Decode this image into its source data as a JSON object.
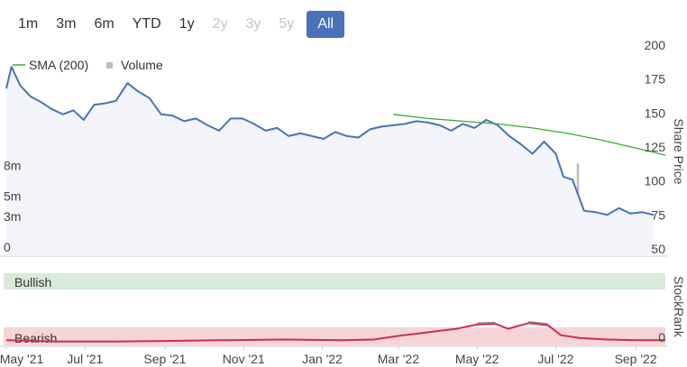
{
  "range_buttons": [
    {
      "label": "1m",
      "state": "enabled"
    },
    {
      "label": "3m",
      "state": "enabled"
    },
    {
      "label": "6m",
      "state": "enabled"
    },
    {
      "label": "YTD",
      "state": "enabled"
    },
    {
      "label": "1y",
      "state": "enabled"
    },
    {
      "label": "2y",
      "state": "disabled"
    },
    {
      "label": "3y",
      "state": "disabled"
    },
    {
      "label": "5y",
      "state": "disabled"
    },
    {
      "label": "All",
      "state": "active"
    }
  ],
  "colors": {
    "price_line": "#4a72b8",
    "price_fill": "#f3f5fa",
    "sma_line": "#3aaa35",
    "volume_bar": "#bdbdbd",
    "bullish_band": "#d8ebd8",
    "bearish_band": "#f5d5d8",
    "stockrank_line": "#c8324a",
    "stockrank_upper": "#8a8a8a",
    "active_button": "#4a72b8"
  },
  "chart_data": [
    {
      "type": "line",
      "title": "",
      "ylabel": "Share Price",
      "ylim": [
        50,
        200
      ],
      "y_ticks": [
        "200",
        "175",
        "150",
        "125",
        "100",
        "75",
        "50"
      ],
      "volume_ticks": [
        "8m",
        "5m",
        "3m",
        "0"
      ],
      "volume_ylim": [
        0,
        10
      ],
      "x_ticks": [
        "May '21",
        "Jul '21",
        "Sep '21",
        "Nov '21",
        "Jan '22",
        "Mar '22",
        "May '22",
        "Jul '22",
        "Sep '22"
      ],
      "legend": [
        {
          "name": "SMA (200)",
          "icon": "line"
        },
        {
          "name": "Volume",
          "icon": "square"
        }
      ],
      "series": [
        {
          "name": "Price",
          "x": [
            "2021-05-01",
            "2021-05-05",
            "2021-05-12",
            "2021-05-20",
            "2021-05-28",
            "2021-06-05",
            "2021-06-14",
            "2021-06-22",
            "2021-06-30",
            "2021-07-08",
            "2021-07-16",
            "2021-07-25",
            "2021-08-03",
            "2021-08-11",
            "2021-08-20",
            "2021-08-29",
            "2021-09-07",
            "2021-09-16",
            "2021-09-25",
            "2021-10-04",
            "2021-10-13",
            "2021-10-22",
            "2021-10-31",
            "2021-11-09",
            "2021-11-18",
            "2021-11-27",
            "2021-12-06",
            "2021-12-15",
            "2021-12-24",
            "2022-01-02",
            "2022-01-11",
            "2022-01-20",
            "2022-01-29",
            "2022-02-07",
            "2022-02-16",
            "2022-02-25",
            "2022-03-06",
            "2022-03-15",
            "2022-03-24",
            "2022-04-02",
            "2022-04-11",
            "2022-04-20",
            "2022-04-29",
            "2022-05-08",
            "2022-05-17",
            "2022-05-26",
            "2022-06-04",
            "2022-06-13",
            "2022-06-22",
            "2022-07-01",
            "2022-07-07",
            "2022-07-14",
            "2022-07-23",
            "2022-08-01",
            "2022-08-10",
            "2022-08-19",
            "2022-08-28",
            "2022-09-06",
            "2022-09-15"
          ],
          "y": [
            168,
            184,
            170,
            162,
            158,
            153,
            149,
            152,
            145,
            156,
            157,
            159,
            172,
            166,
            161,
            149,
            148,
            144,
            146,
            141,
            137,
            146,
            146,
            142,
            137,
            139,
            133,
            135,
            133,
            131,
            136,
            133,
            132,
            138,
            140,
            141,
            142,
            144,
            143,
            141,
            137,
            142,
            139,
            145,
            141,
            133,
            127,
            120,
            129,
            120,
            103,
            101,
            78,
            77,
            75,
            80,
            76,
            77,
            75
          ]
        },
        {
          "name": "SMA (200)",
          "x": [
            "2022-02-25",
            "2022-03-24",
            "2022-04-20",
            "2022-05-17",
            "2022-06-13",
            "2022-07-10",
            "2022-08-06",
            "2022-09-02",
            "2022-09-24"
          ],
          "y": [
            149,
            146,
            144,
            142,
            139,
            135,
            130,
            124,
            119
          ]
        },
        {
          "name": "Volume",
          "x": [
            "2021-05-02",
            "2021-05-08",
            "2021-07-01",
            "2021-08-01",
            "2021-09-20",
            "2021-10-28",
            "2022-01-05",
            "2022-02-10",
            "2022-04-15",
            "2022-06-01",
            "2022-07-18",
            "2022-07-25",
            "2022-08-25"
          ],
          "y": [
            0.4,
            0.3,
            0.3,
            0.5,
            0.3,
            1.7,
            2.6,
            0.3,
            0.3,
            0.4,
            9.0,
            0.6,
            0.5
          ]
        }
      ]
    },
    {
      "type": "line",
      "title": "",
      "ylabel": "StockRank",
      "bands": [
        "Bullish",
        "Bearish"
      ],
      "y_ticks": [
        "0"
      ],
      "ylim": [
        0,
        100
      ],
      "series": [
        {
          "name": "StockRank",
          "x": [
            "2021-05-01",
            "2021-06-10",
            "2021-07-20",
            "2021-09-01",
            "2021-10-15",
            "2021-12-01",
            "2022-01-15",
            "2022-02-10",
            "2022-03-01",
            "2022-03-15",
            "2022-04-01",
            "2022-04-15",
            "2022-05-01",
            "2022-05-15",
            "2022-05-25",
            "2022-06-10",
            "2022-06-25",
            "2022-07-05",
            "2022-07-20",
            "2022-08-10",
            "2022-09-01",
            "2022-09-24"
          ],
          "y": [
            6,
            4,
            4,
            5,
            6,
            7,
            6,
            7,
            12,
            15,
            19,
            22,
            28,
            29,
            22,
            30,
            27,
            13,
            9,
            7,
            6,
            6
          ]
        }
      ]
    }
  ]
}
